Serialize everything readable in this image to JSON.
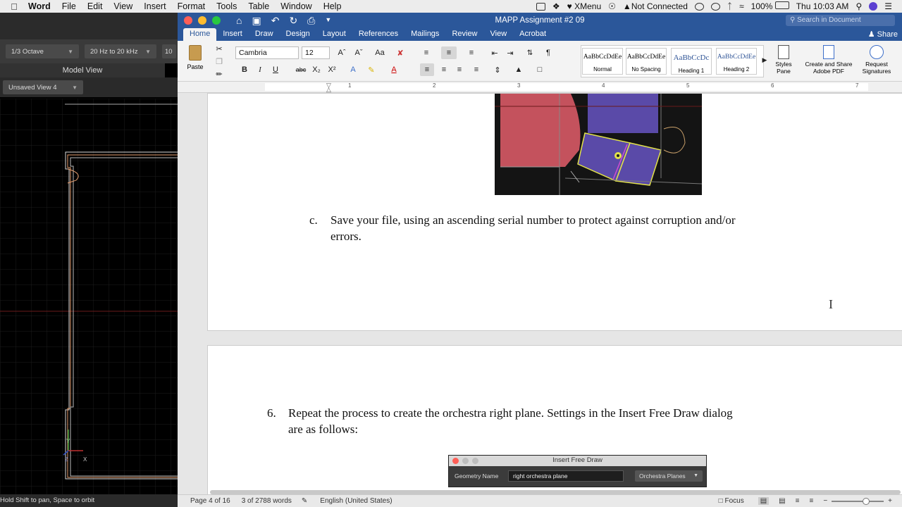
{
  "menubar": {
    "app": "Word",
    "items": [
      "File",
      "Edit",
      "View",
      "Insert",
      "Format",
      "Tools",
      "Table",
      "Window",
      "Help"
    ],
    "xmenu": "XMenu",
    "network": "Not Connected",
    "battery": "100%",
    "clock": "Thu 10:03 AM"
  },
  "leftapp": {
    "dropdown1": "1/3 Octave",
    "dropdown2": "20 Hz to 20 kHz",
    "dropdown3": "10",
    "model_view": "Model View",
    "saved_view": "Unsaved View 4",
    "axis_x": "X",
    "axis_y": "Y",
    "axis_z": "Z",
    "status": "Hold Shift to pan, Space to orbit"
  },
  "word": {
    "title": "MAPP Assignment #2 09",
    "search_placeholder": "Search in Document",
    "tabs": [
      "Home",
      "Insert",
      "Draw",
      "Design",
      "Layout",
      "References",
      "Mailings",
      "Review",
      "View",
      "Acrobat"
    ],
    "share": "Share",
    "paste": "Paste",
    "font": "Cambria",
    "size": "12",
    "styles": [
      {
        "sample": "AaBbCcDdEe",
        "name": "Normal"
      },
      {
        "sample": "AaBbCcDdEe",
        "name": "No Spacing"
      },
      {
        "sample": "AaBbCcDc",
        "name": "Heading 1"
      },
      {
        "sample": "AaBbCcDdEe",
        "name": "Heading 2"
      }
    ],
    "styles_pane": "Styles Pane",
    "create_share_line1": "Create and Share",
    "create_share_line2": "Adobe PDF",
    "request_line1": "Request",
    "request_line2": "Signatures",
    "ruler_numbers": [
      "1",
      "2",
      "3",
      "4",
      "5",
      "6",
      "7"
    ]
  },
  "document": {
    "item_c_marker": "c.",
    "item_c_line1": "Save your file, using an ascending serial number to protect against corruption and/or",
    "item_c_line2": "errors.",
    "item_6_marker": "6.",
    "item_6_line1": "Repeat the process to create the orchestra right plane.  Settings in the Insert Free Draw dialog",
    "item_6_line2": "are as follows:",
    "dialog_title": "Insert Free Draw",
    "dialog_label": "Geometry Name",
    "dialog_value": "right orchestra plane",
    "dialog_select": "Orchestra Planes"
  },
  "statusbar": {
    "page": "Page 4 of 16",
    "words": "3 of 2788 words",
    "language": "English (United States)",
    "focus": "Focus"
  }
}
